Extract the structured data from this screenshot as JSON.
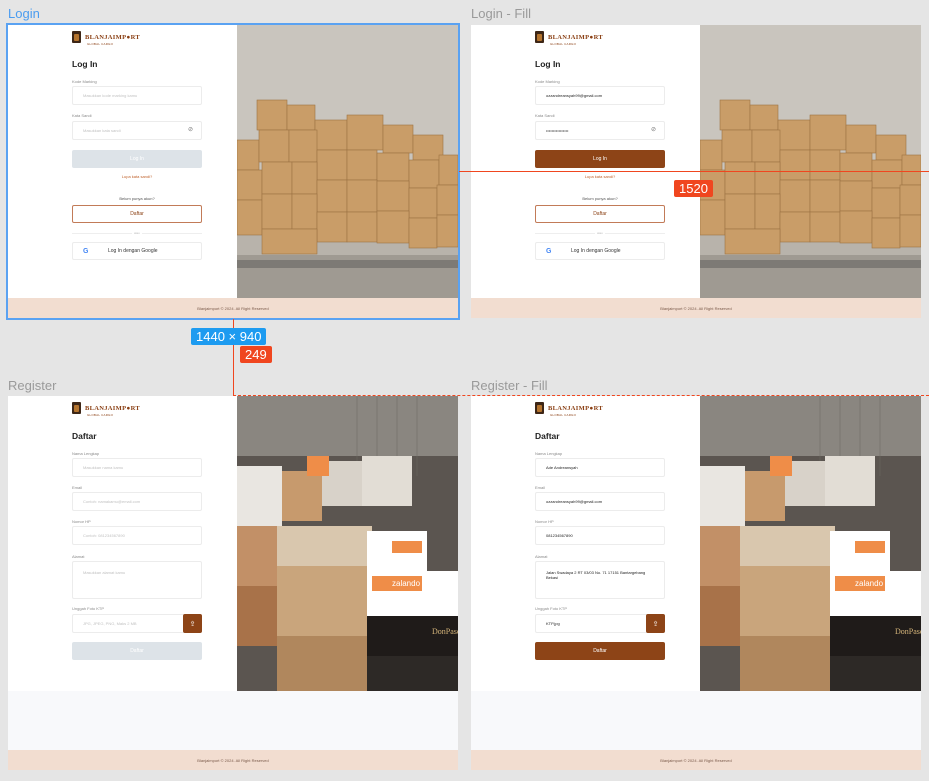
{
  "frames": {
    "login": {
      "label": "Login",
      "title": "Log In",
      "kode_label": "Kode Marking",
      "kode_placeholder": "Masukkan kode marking kamu",
      "pass_label": "Kata Sandi",
      "pass_placeholder": "Masukkan kata sandi",
      "login_btn": "Log In",
      "forgot": "Lupa kata sandi?",
      "no_account": "Belum punya akun?",
      "register_btn": "Daftar",
      "or": "atau",
      "google_btn": "Log In dengan Google",
      "footer": "Blanjaimport © 2024. All Right Reserved"
    },
    "login_fill": {
      "label": "Login - Fill",
      "title": "Log In",
      "kode_label": "Kode Marking",
      "kode_value": "ozzandreansyah99@gmail.com",
      "pass_label": "Kata Sandi",
      "pass_value": "••••••••••••••••",
      "login_btn": "Log In",
      "forgot": "Lupa kata sandi?",
      "no_account": "Belum punya akun?",
      "register_btn": "Daftar",
      "or": "atau",
      "google_btn": "Log In dengan Google",
      "footer": "Blanjaimport © 2024. All Right Reserved"
    },
    "register": {
      "label": "Register",
      "title": "Daftar",
      "name_label": "Nama Lengkap",
      "name_placeholder": "Masukkan nama kamu",
      "email_label": "Email",
      "email_placeholder": "Contoh: namakamu@email.com",
      "phone_label": "Nomor HP",
      "phone_placeholder": "Contoh: 081234567890",
      "address_label": "Alamat",
      "address_placeholder": "Masukkan alamat kamu",
      "ktp_label": "Unggah Foto KTP",
      "ktp_placeholder": "JPG, JPEG, PNG, Maks 2 MB",
      "submit_btn": "Daftar",
      "footer": "Blanjaimport © 2024. All Right Reserved"
    },
    "register_fill": {
      "label": "Register - Fill",
      "title": "Daftar",
      "name_label": "Nama Lengkap",
      "name_value": "Ade Andreansyah",
      "email_label": "Email",
      "email_value": "ozzandreansyah99@gmail.com",
      "phone_label": "Nomor HP",
      "phone_value": "081234567890",
      "address_label": "Alamat",
      "address_value": "Jalan Swadaya 2 RT 03/03 No. 71 17151 Bantargebang Bekasi",
      "ktp_label": "Unggah Foto KTP",
      "ktp_value": "KTP.jpg",
      "submit_btn": "Daftar",
      "footer": "Blanjaimport © 2024. All Right Reserved"
    }
  },
  "brand": {
    "name": "BLANJAIMP●RT",
    "tagline": "GLOBAL CARGO"
  },
  "overlays": {
    "dimension": "1440 × 940",
    "distance_h": "1520",
    "distance_v": "249"
  },
  "colors": {
    "primary": "#8d4417",
    "footer": "#f2ddd0",
    "selection": "#1d9bf0",
    "measure": "#f0461f"
  }
}
